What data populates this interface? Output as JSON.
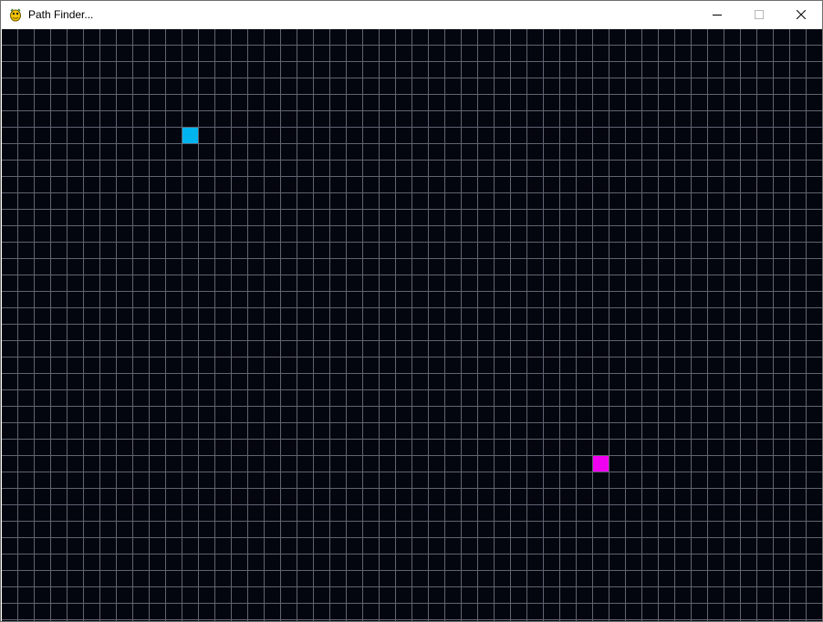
{
  "window": {
    "title": "Path Finder..."
  },
  "icons": {
    "app": "pygame-snake-icon",
    "minimize": "minimize-icon",
    "maximize": "maximize-icon",
    "close": "close-icon"
  },
  "grid": {
    "columns": 50,
    "rows": 36,
    "background": "#03060f",
    "line_color": "#5f6470",
    "start_color": "#00b4f0",
    "end_color": "#f000f0",
    "start_node": {
      "col": 11,
      "row": 6
    },
    "end_node": {
      "col": 36,
      "row": 26
    }
  }
}
